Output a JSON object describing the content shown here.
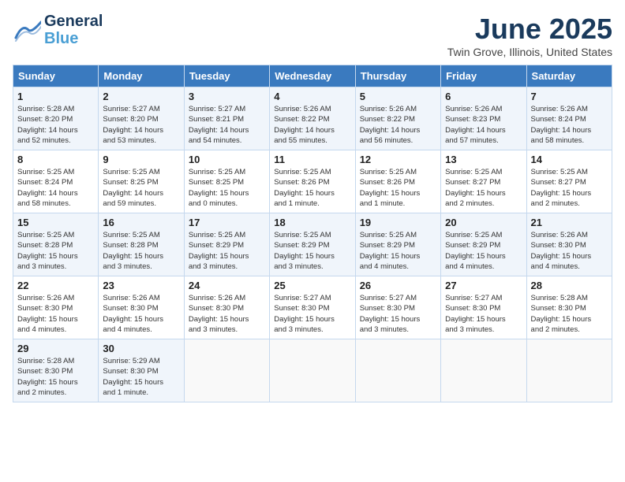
{
  "header": {
    "logo_line1": "General",
    "logo_line2": "Blue",
    "title": "June 2025",
    "subtitle": "Twin Grove, Illinois, United States"
  },
  "weekdays": [
    "Sunday",
    "Monday",
    "Tuesday",
    "Wednesday",
    "Thursday",
    "Friday",
    "Saturday"
  ],
  "weeks": [
    [
      {
        "day": "1",
        "info": "Sunrise: 5:28 AM\nSunset: 8:20 PM\nDaylight: 14 hours\nand 52 minutes."
      },
      {
        "day": "2",
        "info": "Sunrise: 5:27 AM\nSunset: 8:20 PM\nDaylight: 14 hours\nand 53 minutes."
      },
      {
        "day": "3",
        "info": "Sunrise: 5:27 AM\nSunset: 8:21 PM\nDaylight: 14 hours\nand 54 minutes."
      },
      {
        "day": "4",
        "info": "Sunrise: 5:26 AM\nSunset: 8:22 PM\nDaylight: 14 hours\nand 55 minutes."
      },
      {
        "day": "5",
        "info": "Sunrise: 5:26 AM\nSunset: 8:22 PM\nDaylight: 14 hours\nand 56 minutes."
      },
      {
        "day": "6",
        "info": "Sunrise: 5:26 AM\nSunset: 8:23 PM\nDaylight: 14 hours\nand 57 minutes."
      },
      {
        "day": "7",
        "info": "Sunrise: 5:26 AM\nSunset: 8:24 PM\nDaylight: 14 hours\nand 58 minutes."
      }
    ],
    [
      {
        "day": "8",
        "info": "Sunrise: 5:25 AM\nSunset: 8:24 PM\nDaylight: 14 hours\nand 58 minutes."
      },
      {
        "day": "9",
        "info": "Sunrise: 5:25 AM\nSunset: 8:25 PM\nDaylight: 14 hours\nand 59 minutes."
      },
      {
        "day": "10",
        "info": "Sunrise: 5:25 AM\nSunset: 8:25 PM\nDaylight: 15 hours\nand 0 minutes."
      },
      {
        "day": "11",
        "info": "Sunrise: 5:25 AM\nSunset: 8:26 PM\nDaylight: 15 hours\nand 1 minute."
      },
      {
        "day": "12",
        "info": "Sunrise: 5:25 AM\nSunset: 8:26 PM\nDaylight: 15 hours\nand 1 minute."
      },
      {
        "day": "13",
        "info": "Sunrise: 5:25 AM\nSunset: 8:27 PM\nDaylight: 15 hours\nand 2 minutes."
      },
      {
        "day": "14",
        "info": "Sunrise: 5:25 AM\nSunset: 8:27 PM\nDaylight: 15 hours\nand 2 minutes."
      }
    ],
    [
      {
        "day": "15",
        "info": "Sunrise: 5:25 AM\nSunset: 8:28 PM\nDaylight: 15 hours\nand 3 minutes."
      },
      {
        "day": "16",
        "info": "Sunrise: 5:25 AM\nSunset: 8:28 PM\nDaylight: 15 hours\nand 3 minutes."
      },
      {
        "day": "17",
        "info": "Sunrise: 5:25 AM\nSunset: 8:29 PM\nDaylight: 15 hours\nand 3 minutes."
      },
      {
        "day": "18",
        "info": "Sunrise: 5:25 AM\nSunset: 8:29 PM\nDaylight: 15 hours\nand 3 minutes."
      },
      {
        "day": "19",
        "info": "Sunrise: 5:25 AM\nSunset: 8:29 PM\nDaylight: 15 hours\nand 4 minutes."
      },
      {
        "day": "20",
        "info": "Sunrise: 5:25 AM\nSunset: 8:29 PM\nDaylight: 15 hours\nand 4 minutes."
      },
      {
        "day": "21",
        "info": "Sunrise: 5:26 AM\nSunset: 8:30 PM\nDaylight: 15 hours\nand 4 minutes."
      }
    ],
    [
      {
        "day": "22",
        "info": "Sunrise: 5:26 AM\nSunset: 8:30 PM\nDaylight: 15 hours\nand 4 minutes."
      },
      {
        "day": "23",
        "info": "Sunrise: 5:26 AM\nSunset: 8:30 PM\nDaylight: 15 hours\nand 4 minutes."
      },
      {
        "day": "24",
        "info": "Sunrise: 5:26 AM\nSunset: 8:30 PM\nDaylight: 15 hours\nand 3 minutes."
      },
      {
        "day": "25",
        "info": "Sunrise: 5:27 AM\nSunset: 8:30 PM\nDaylight: 15 hours\nand 3 minutes."
      },
      {
        "day": "26",
        "info": "Sunrise: 5:27 AM\nSunset: 8:30 PM\nDaylight: 15 hours\nand 3 minutes."
      },
      {
        "day": "27",
        "info": "Sunrise: 5:27 AM\nSunset: 8:30 PM\nDaylight: 15 hours\nand 3 minutes."
      },
      {
        "day": "28",
        "info": "Sunrise: 5:28 AM\nSunset: 8:30 PM\nDaylight: 15 hours\nand 2 minutes."
      }
    ],
    [
      {
        "day": "29",
        "info": "Sunrise: 5:28 AM\nSunset: 8:30 PM\nDaylight: 15 hours\nand 2 minutes."
      },
      {
        "day": "30",
        "info": "Sunrise: 5:29 AM\nSunset: 8:30 PM\nDaylight: 15 hours\nand 1 minute."
      },
      {
        "day": "",
        "info": ""
      },
      {
        "day": "",
        "info": ""
      },
      {
        "day": "",
        "info": ""
      },
      {
        "day": "",
        "info": ""
      },
      {
        "day": "",
        "info": ""
      }
    ]
  ]
}
